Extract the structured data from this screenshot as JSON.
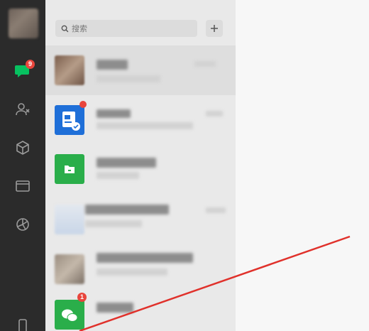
{
  "search": {
    "placeholder": "搜索"
  },
  "nav": {
    "chat_badge": "9",
    "items": [
      "chat-icon",
      "contacts-icon",
      "favorites-icon",
      "files-icon",
      "moments-icon",
      "phone-icon"
    ]
  },
  "chats": {
    "rows": [
      {
        "badge": ""
      },
      {
        "badge": ""
      },
      {
        "badge": ""
      },
      {
        "badge": ""
      },
      {
        "badge": ""
      },
      {
        "badge": "1"
      }
    ]
  },
  "colors": {
    "accent_green": "#07c160",
    "badge_red": "#e8453c",
    "annotation_arrow": "#e0312b"
  }
}
